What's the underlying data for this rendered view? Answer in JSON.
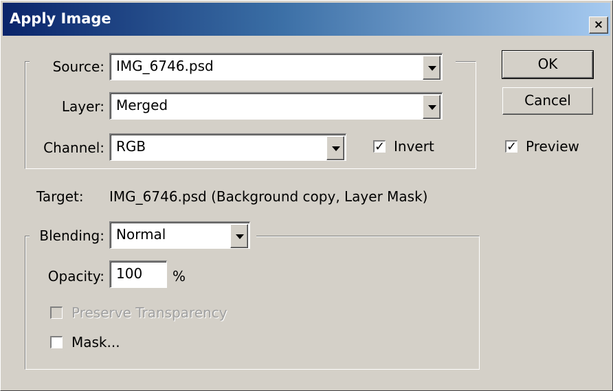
{
  "window": {
    "title": "Apply Image",
    "close_glyph": "×"
  },
  "source": {
    "source_label": "Source:",
    "source_value": "IMG_6746.psd",
    "layer_label": "Layer:",
    "layer_value": "Merged",
    "channel_label": "Channel:",
    "channel_value": "RGB",
    "invert_label": "Invert",
    "invert_checked": true
  },
  "target": {
    "label": "Target:",
    "value": "IMG_6746.psd (Background copy, Layer Mask)"
  },
  "blending": {
    "blending_label": "Blending:",
    "blending_value": "Normal",
    "opacity_label": "Opacity:",
    "opacity_value": "100",
    "opacity_unit": "%",
    "preserve_label": "Preserve Transparency",
    "preserve_checked": false,
    "preserve_enabled": false,
    "mask_label": "Mask...",
    "mask_checked": false
  },
  "buttons": {
    "ok": "OK",
    "cancel": "Cancel"
  },
  "preview": {
    "label": "Preview",
    "checked": true
  },
  "icons": {
    "dropdown": "dropdown-arrow-icon",
    "check": "check-icon"
  }
}
